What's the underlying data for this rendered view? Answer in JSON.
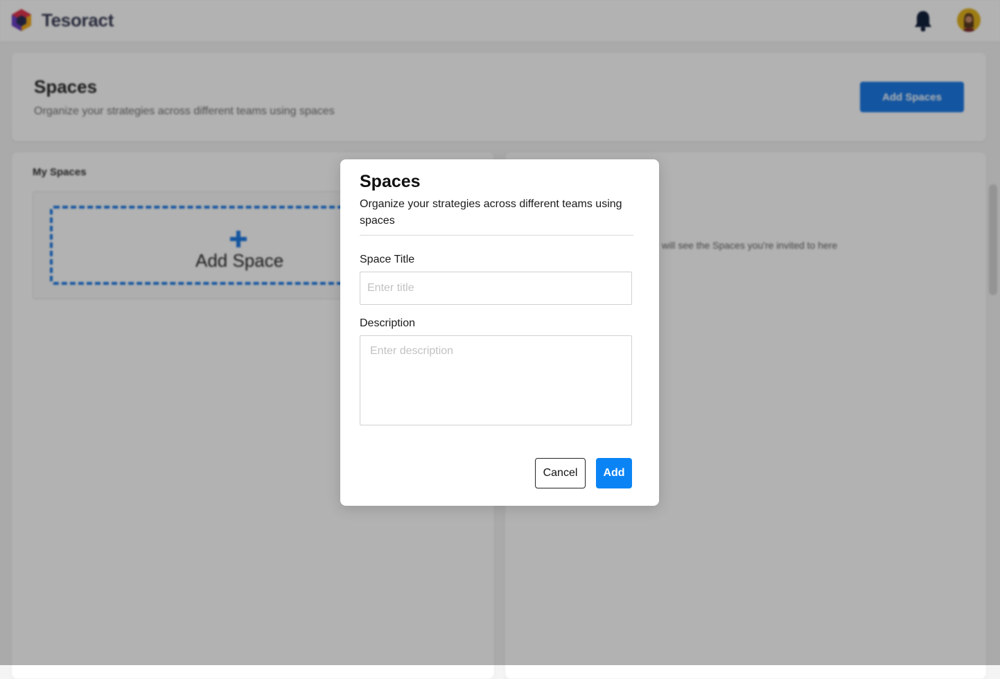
{
  "topbar": {
    "brand": "Tesoract",
    "logo_icon": "tesoract-logo-icon",
    "notification_icon": "bell-icon",
    "avatar_icon": "user-avatar"
  },
  "header": {
    "title": "Spaces",
    "subtitle": "Organize your strategies across different teams using spaces",
    "add_button_label": "Add Spaces"
  },
  "my_spaces": {
    "heading": "My Spaces",
    "add_space_label": "Add Space"
  },
  "shared_spaces": {
    "partial_text": "will see the Spaces you're invited to here"
  },
  "modal": {
    "title": "Spaces",
    "subtitle": "Organize your strategies across different teams using spaces",
    "space_title_label": "Space Title",
    "space_title_value": "",
    "space_title_placeholder": "Enter title",
    "description_label": "Description",
    "description_value": "",
    "description_placeholder": "Enter description",
    "cancel_label": "Cancel",
    "add_label": "Add"
  },
  "colors": {
    "primary": "#0a84f5",
    "brand_text": "#3b3f58"
  }
}
